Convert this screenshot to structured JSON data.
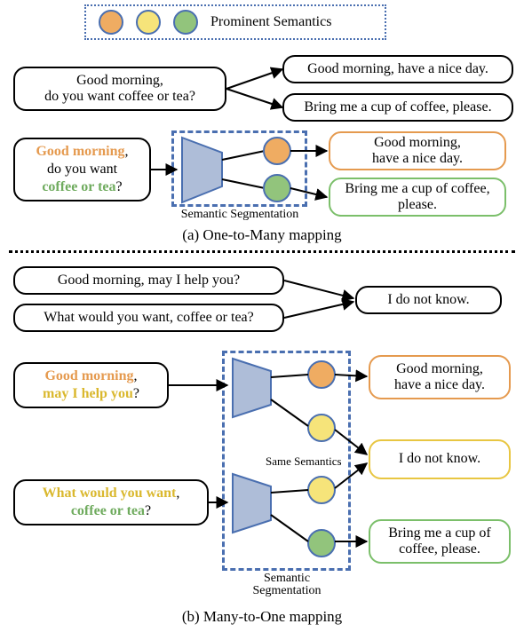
{
  "legend": {
    "label": "Prominent Semantics",
    "circles": [
      "orange",
      "yellow",
      "green"
    ]
  },
  "panel_a": {
    "caption": "(a) One-to-Many mapping",
    "plain_input": "Good morning,\ndo you want coffee or tea?",
    "plain_output_top": "Good morning, have a nice day.",
    "plain_output_bot": "Bring me a cup of coffee, please.",
    "hl_input": {
      "seg_orange": "Good morning",
      "seg_black1": ",\ndo you want\n",
      "seg_green": "coffee or tea",
      "seg_black2": "?"
    },
    "seg_label": "Semantic Segmentation",
    "out_orange": "Good morning,\nhave a nice day.",
    "out_green": "Bring me a cup of coffee,\nplease."
  },
  "panel_b": {
    "caption": "(b) Many-to-One mapping",
    "plain_input_top": "Good morning, may I help you?",
    "plain_input_bot": "What would you want, coffee or tea?",
    "plain_output": "I do not know.",
    "hl_input_top": {
      "seg_orange": "Good morning",
      "seg_black1": ",\n",
      "seg_yellow": "may I help you",
      "seg_black2": "?"
    },
    "hl_input_bot": {
      "seg_yellow": "What would you want",
      "seg_black1": ",\n",
      "seg_green": "coffee or tea",
      "seg_black2": "?"
    },
    "seg_label": "Semantic\nSegmentation",
    "same_sem": "Same Semantics",
    "out_orange": "Good morning,\nhave a nice day.",
    "out_yellow": "I do not know.",
    "out_green": "Bring me a cup of\ncoffee, please."
  }
}
